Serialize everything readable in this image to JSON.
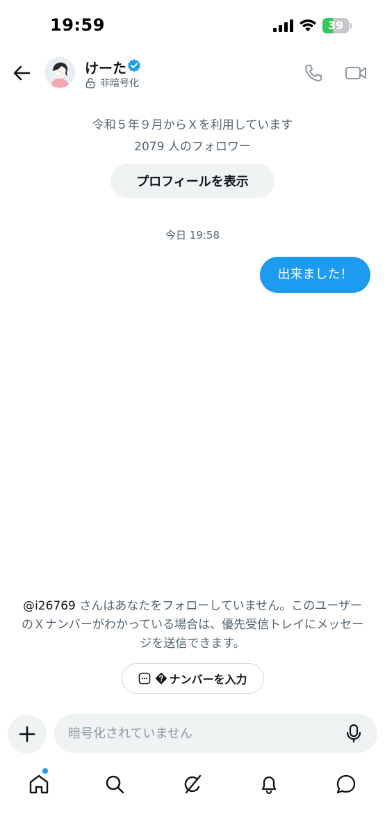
{
  "status_bar": {
    "time": "19:59",
    "battery_text": "39",
    "battery_level": 0.39,
    "icons": [
      "cellular-signal-icon",
      "wifi-icon",
      "battery-charging-icon"
    ]
  },
  "header": {
    "name": "けーた",
    "encryption_label": "非暗号化",
    "verified": true,
    "icons": [
      "back-arrow-icon",
      "verified-badge-icon",
      "unlock-icon",
      "phone-icon",
      "video-camera-icon"
    ]
  },
  "profile": {
    "joined": "令和５年９月からＸを利用しています",
    "followers": "2079 人のフォロワー",
    "show_profile_label": "プロフィールを表示"
  },
  "conversation": {
    "timestamp": "今日 19:58",
    "messages": [
      {
        "from": "me",
        "text": "出来ました！"
      }
    ]
  },
  "notice": {
    "handle": "@i26769",
    "text": " さんはあなたをフォローしていません。このユーザーのＸナンバーがわかっている場合は、優先受信トレイにメッセージを送信できます。",
    "number_button_label": "ナンバーを入力"
  },
  "composer": {
    "placeholder": "暗号化されていません",
    "icons": [
      "plus-icon",
      "microphone-icon"
    ]
  },
  "bottom_nav": {
    "items": [
      "home-icon",
      "search-icon",
      "grok-icon",
      "notifications-bell-icon",
      "messages-icon"
    ],
    "home_has_badge": true
  },
  "colors": {
    "accent": "#1d9bf0",
    "text_primary": "#0f1419",
    "text_secondary": "#536471",
    "pill_background": "#eff3f4",
    "battery_green": "#34c759"
  }
}
